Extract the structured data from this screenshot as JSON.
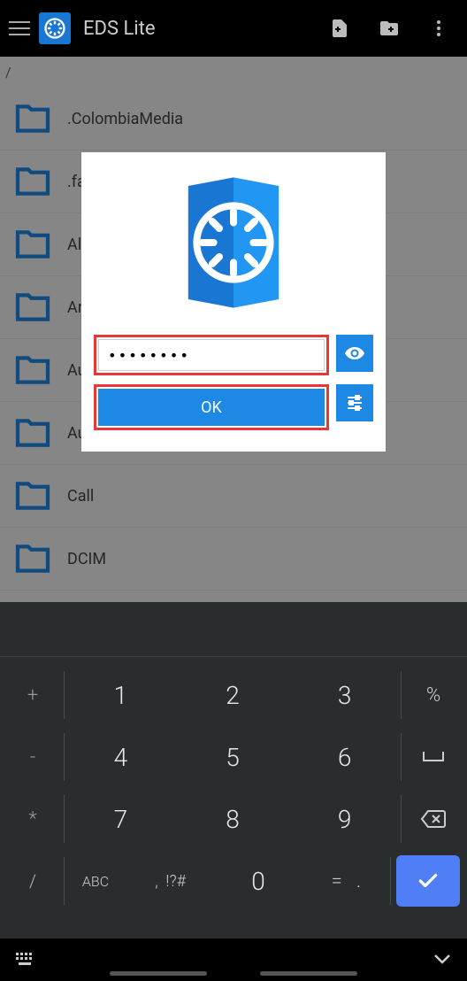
{
  "appbar": {
    "title": "EDS Lite"
  },
  "breadcrumb": "/",
  "files": [
    ".ColombiaMedia",
    ".fa",
    "Al",
    "An",
    "Au",
    "Autodesk",
    "Call",
    "DCIM"
  ],
  "dialog": {
    "password_value": "••••••••",
    "ok_label": "OK"
  },
  "keyboard": {
    "side_left": [
      "+",
      "-",
      "*",
      "/"
    ],
    "grid": [
      [
        "1",
        "2",
        "3"
      ],
      [
        "4",
        "5",
        "6"
      ],
      [
        "7",
        "8",
        "9"
      ],
      [
        ",  !?#",
        "0",
        "=   ."
      ]
    ],
    "side_right_labels": [
      "%",
      "␣",
      "⌫",
      "✓"
    ],
    "abc_label": "ABC"
  }
}
